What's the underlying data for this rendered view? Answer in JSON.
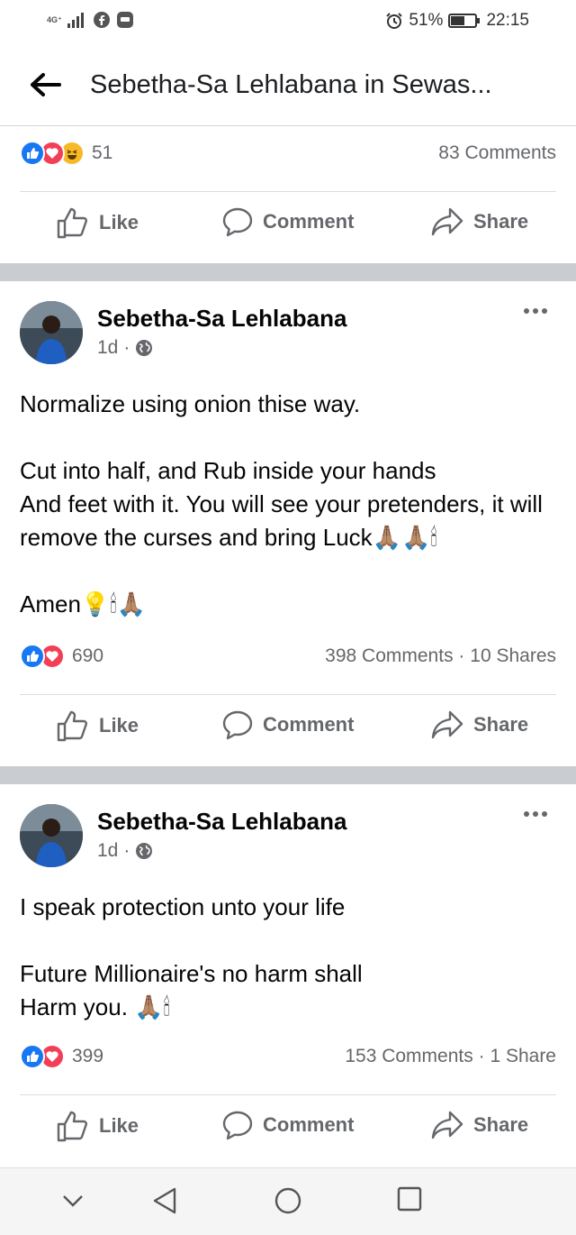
{
  "status_bar": {
    "network": "4G⁺",
    "battery": "51%",
    "time": "22:15",
    "icons": [
      "signal-icon",
      "facebook-notification-icon",
      "huawei-notification-icon",
      "alarm-icon",
      "battery-icon"
    ]
  },
  "topbar": {
    "title": "Sebetha-Sa Lehlabana in Sewas..."
  },
  "colors": {
    "like_blue": "#1877f2",
    "love_red": "#f33e58",
    "haha_yellow": "#f7b928",
    "text_secondary": "#65676b",
    "separator": "#c9ccd1"
  },
  "actions": {
    "like": "Like",
    "comment": "Comment",
    "share": "Share"
  },
  "top_post": {
    "reaction_count": "51",
    "stats_right": "83 Comments"
  },
  "posts": [
    {
      "author": "Sebetha-Sa Lehlabana",
      "time": "1d",
      "separator": "·",
      "paragraphs": [
        "Normalize using onion thise way.",
        "Cut into half, and Rub inside your hands\nAnd feet with it. You will see your pretenders, it will remove the curses and bring Luck🙏🏽🙏🏽🕯",
        "Amen💡🕯🙏🏽"
      ],
      "reaction_count": "690",
      "comments": "398 Comments",
      "shares": "10 Shares"
    },
    {
      "author": "Sebetha-Sa Lehlabana",
      "time": "1d",
      "separator": "·",
      "paragraphs": [
        "I speak protection unto your life",
        "Future Millionaire's no harm shall\nHarm you. 🙏🏽🕯"
      ],
      "reaction_count": "399",
      "comments": "153 Comments",
      "shares": "1 Share"
    }
  ],
  "navigation": {
    "icons": [
      "chevron-down-icon",
      "back-triangle-icon",
      "home-circle-icon",
      "recents-square-icon"
    ]
  }
}
